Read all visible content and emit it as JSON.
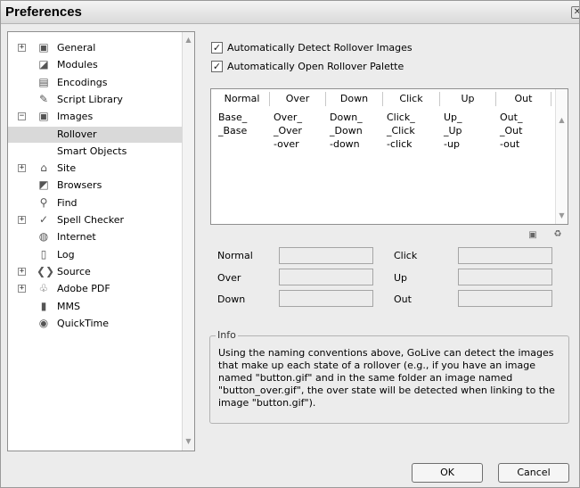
{
  "window": {
    "title": "Preferences",
    "close_glyph": "✕"
  },
  "sidebar": {
    "items": [
      {
        "label": "General",
        "expander": "+",
        "icon": "general-icon",
        "glyph": "▣"
      },
      {
        "label": "Modules",
        "expander": "",
        "icon": "modules-icon",
        "glyph": "◪"
      },
      {
        "label": "Encodings",
        "expander": "",
        "icon": "encodings-icon",
        "glyph": "▤"
      },
      {
        "label": "Script Library",
        "expander": "",
        "icon": "script-library-icon",
        "glyph": "✎"
      },
      {
        "label": "Images",
        "expander": "−",
        "icon": "images-icon",
        "glyph": "▣"
      },
      {
        "label": "Rollover",
        "expander": "",
        "icon": "",
        "glyph": "",
        "selected": true
      },
      {
        "label": "Smart Objects",
        "expander": "",
        "icon": "",
        "glyph": ""
      },
      {
        "label": "Site",
        "expander": "+",
        "icon": "site-icon",
        "glyph": "⌂"
      },
      {
        "label": "Browsers",
        "expander": "",
        "icon": "browsers-icon",
        "glyph": "◩"
      },
      {
        "label": "Find",
        "expander": "",
        "icon": "find-icon",
        "glyph": "⚲"
      },
      {
        "label": "Spell Checker",
        "expander": "+",
        "icon": "spell-checker-icon",
        "glyph": "✓"
      },
      {
        "label": "Internet",
        "expander": "",
        "icon": "internet-icon",
        "glyph": "◍"
      },
      {
        "label": "Log",
        "expander": "",
        "icon": "log-icon",
        "glyph": "▯"
      },
      {
        "label": "Source",
        "expander": "+",
        "icon": "source-icon",
        "glyph": "❮❯"
      },
      {
        "label": "Adobe PDF",
        "expander": "+",
        "icon": "adobe-pdf-icon",
        "glyph": "♧"
      },
      {
        "label": "MMS",
        "expander": "",
        "icon": "mms-icon",
        "glyph": "▮"
      },
      {
        "label": "QuickTime",
        "expander": "",
        "icon": "quicktime-icon",
        "glyph": "◉"
      }
    ],
    "scroll_up": "▲",
    "scroll_down": "▼"
  },
  "options": {
    "detect_label": "Automatically Detect Rollover Images",
    "open_palette_label": "Automatically Open Rollover Palette",
    "check_glyph": "✓"
  },
  "table": {
    "headers": [
      "Normal",
      "Over",
      "Down",
      "Click",
      "Up",
      "Out"
    ],
    "rows": [
      [
        "Base_",
        "Over_",
        "Down_",
        "Click_",
        "Up_",
        "Out_"
      ],
      [
        "_Base",
        "_Over",
        "_Down",
        "_Click",
        "_Up",
        "_Out"
      ],
      [
        "",
        "-over",
        "-down",
        "-click",
        "-up",
        "-out"
      ]
    ],
    "scroll_up": "▲",
    "scroll_down": "▼",
    "new_glyph": "▣",
    "trash_glyph": "♻"
  },
  "fields": {
    "normal": "Normal",
    "over": "Over",
    "down": "Down",
    "click": "Click",
    "up": "Up",
    "out": "Out"
  },
  "info": {
    "title": "Info",
    "text": "Using the naming conventions above, GoLive can detect the images that make up each state of a rollover (e.g., if you have an image named \"button.gif\" and in the same folder an image named \"button_over.gif\", the over state will be detected when linking to the image \"button.gif\")."
  },
  "buttons": {
    "ok": "OK",
    "cancel": "Cancel"
  }
}
